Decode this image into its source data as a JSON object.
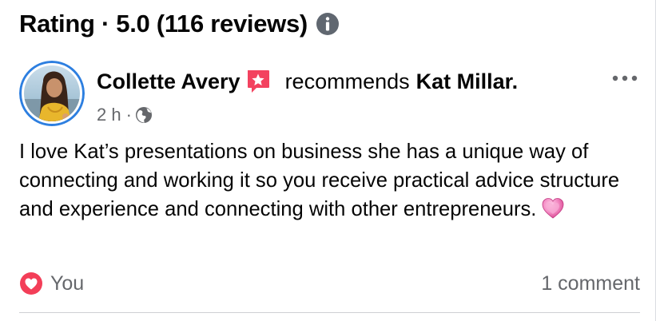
{
  "header": {
    "title": "Rating · 5.0 (116 reviews)",
    "info_icon": "info-icon"
  },
  "review": {
    "author": "Collette Avery",
    "recommend_icon": "recommend-flag-icon",
    "verb": "recommends",
    "target": "Kat Millar.",
    "time": "2 h",
    "separator": "·",
    "privacy_icon": "globe-icon",
    "more_icon": "more-options-icon",
    "text": "I love Kat’s presentations on business she has a unique way of connecting and working it so you receive practical advice structure and experience and connecting with other entrepreneurs.",
    "emoji": "pink-heart-emoji"
  },
  "footer": {
    "reaction_icon": "love-reaction-icon",
    "reaction_label": "You",
    "comments_label": "1 comment"
  },
  "colors": {
    "text": "#050505",
    "secondary_text": "#65676b",
    "recommend_red": "#f3425f",
    "avatar_ring": "#1b74e4",
    "divider": "#ced0d4"
  }
}
